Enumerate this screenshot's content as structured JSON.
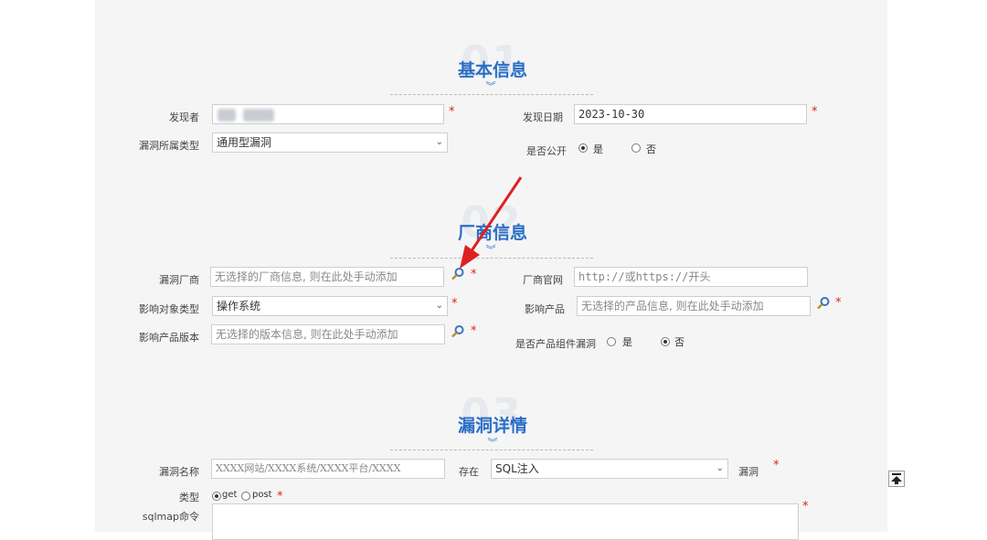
{
  "sections": {
    "basic": {
      "number": "01",
      "title": "基本信息"
    },
    "vendor": {
      "number": "02",
      "title": "厂商信息"
    },
    "details": {
      "number": "03",
      "title": "漏洞详情"
    }
  },
  "basic": {
    "discoverer_label": "发现者",
    "discoverer_value": "",
    "date_label": "发现日期",
    "date_value": "2023-10-30",
    "vuln_type_label": "漏洞所属类型",
    "vuln_type_value": "通用型漏洞",
    "public_label": "是否公开",
    "public_yes": "是",
    "public_no": "否",
    "public_selected": "是"
  },
  "vendor": {
    "vendor_label": "漏洞厂商",
    "vendor_placeholder": "无选择的厂商信息, 则在此处手动添加",
    "website_label": "厂商官网",
    "website_placeholder": "http://或https://开头",
    "target_type_label": "影响对象类型",
    "target_type_value": "操作系统",
    "product_label": "影响产品",
    "product_placeholder": "无选择的产品信息, 则在此处手动添加",
    "version_label": "影响产品版本",
    "version_placeholder": "无选择的版本信息, 则在此处手动添加",
    "component_label": "是否产品组件漏洞",
    "component_yes": "是",
    "component_no": "否",
    "component_selected": "否"
  },
  "details": {
    "name_label": "漏洞名称",
    "name_placeholder": "XXXX网站/XXXX系统/XXXX平台/XXXX",
    "exists_label": "存在",
    "exists_value": "SQL注入",
    "vuln_suffix": "漏洞",
    "type_label": "类型",
    "type_get": "get",
    "type_post": "post",
    "type_selected": "get",
    "sqlmap_label": "sqlmap命令"
  },
  "colors": {
    "accent": "#2a6ec6",
    "required": "#e02020",
    "annotation_arrow": "#e02020"
  },
  "icons": {
    "search": "search-icon",
    "back_to_top": "back-to-top-icon",
    "chevron": "chevron-double-down-icon"
  }
}
